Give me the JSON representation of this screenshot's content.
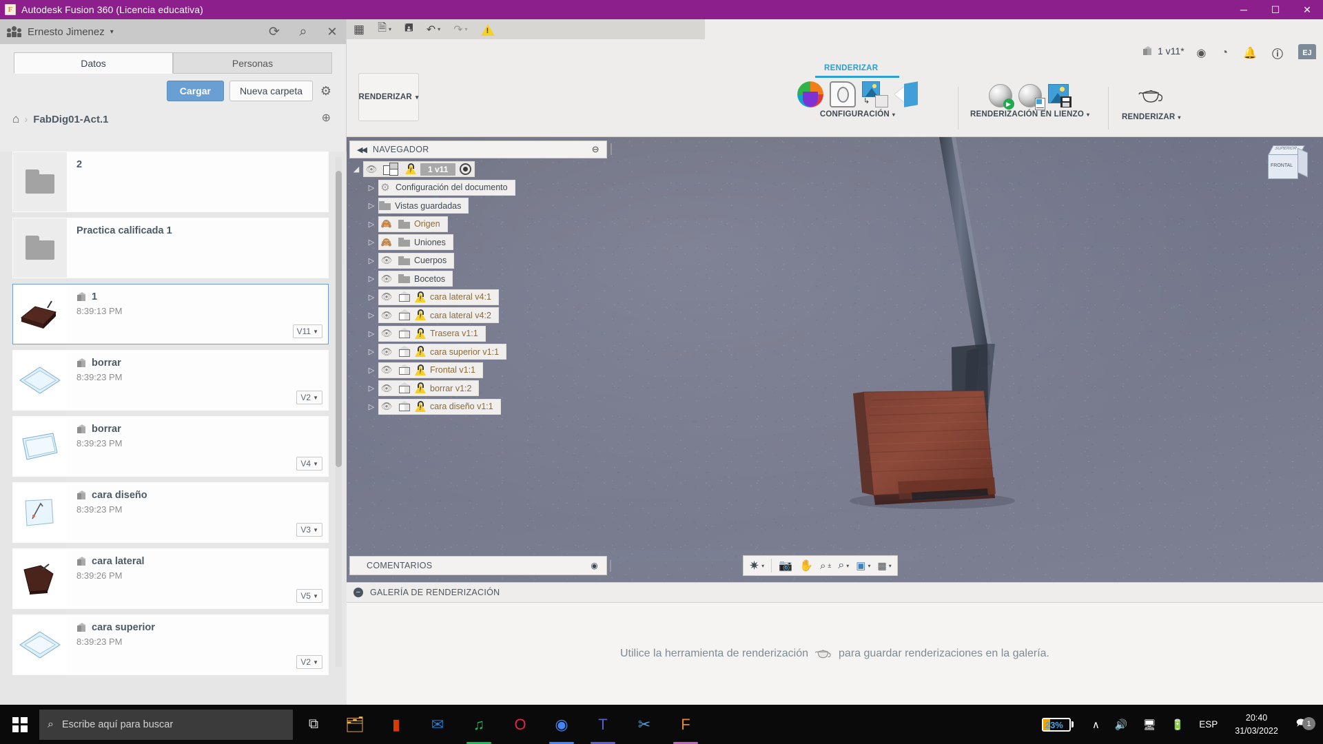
{
  "titlebar": {
    "app_title": "Autodesk Fusion 360 (Licencia educativa)",
    "logo_letter": "F",
    "minimize": "─",
    "maximize": "☐",
    "close": "✕",
    "accent_color": "#8d1f8d"
  },
  "data_panel": {
    "user_name": "Ernesto Jimenez",
    "user_caret": "▾",
    "refresh_icon": "⟳",
    "search_icon": "⌕",
    "close_icon": "✕",
    "tabs": [
      {
        "label": "Datos",
        "active": true
      },
      {
        "label": "Personas",
        "active": false
      }
    ],
    "upload_button": "Cargar",
    "new_folder_button": "Nueva carpeta",
    "settings_icon": "⚙",
    "breadcrumb": {
      "home_icon": "⌂",
      "separator": "›",
      "path": "FabDig01-Act.1",
      "globe_icon": "⊕"
    },
    "items": [
      {
        "type": "folder",
        "name": "2",
        "time": "",
        "version": ""
      },
      {
        "type": "folder",
        "name": "Practica calificada 1",
        "time": "",
        "version": ""
      },
      {
        "type": "file",
        "name": "1",
        "time": "8:39:13 PM",
        "version": "V11",
        "selected": true
      },
      {
        "type": "file",
        "name": "borrar",
        "time": "8:39:23 PM",
        "version": "V2",
        "selected": false
      },
      {
        "type": "file",
        "name": "borrar",
        "time": "8:39:23 PM",
        "version": "V4",
        "selected": false
      },
      {
        "type": "file",
        "name": "cara diseño",
        "time": "8:39:23 PM",
        "version": "V3",
        "selected": false
      },
      {
        "type": "file",
        "name": "cara lateral",
        "time": "8:39:26 PM",
        "version": "V5",
        "selected": false
      },
      {
        "type": "file",
        "name": "cara superior",
        "time": "8:39:23 PM",
        "version": "V2",
        "selected": false
      }
    ]
  },
  "fusion": {
    "quick_access": [
      {
        "name": "grid-icon",
        "glyph": "☷"
      },
      {
        "name": "new-file-icon",
        "glyph": "⬚",
        "caret": "▾"
      },
      {
        "name": "save-icon",
        "glyph": "⬜"
      },
      {
        "name": "undo-icon",
        "glyph": "↶",
        "caret": "▾"
      },
      {
        "name": "redo-icon",
        "glyph": "↷",
        "caret": "▾"
      },
      {
        "name": "warning-icon",
        "glyph": "⚠"
      }
    ],
    "document_tab": {
      "title": "1 v11*",
      "close": "✕",
      "add": "+"
    },
    "right_icons": [
      {
        "name": "extensions-icon",
        "glyph": "⊙"
      },
      {
        "name": "history-icon",
        "glyph": "◔"
      },
      {
        "name": "notifications-icon",
        "glyph": "🔔"
      },
      {
        "name": "help-icon",
        "glyph": "?"
      }
    ],
    "avatar_initials": "EJ",
    "workspace_button": "RENDERIZAR",
    "workspace_caret": "▾",
    "ribbon_tab": "RENDERIZAR",
    "ribbon_groups": [
      {
        "caption": "CONFIGURACIÓN",
        "caret": "▾",
        "tools": [
          "color-wheel-icon",
          "appearance-icon",
          "scene-settings-icon",
          "decal-icon"
        ]
      },
      {
        "caption": "RENDERIZACIÓN EN LIENZO",
        "caret": "▾",
        "tools": [
          "canvas-render-icon",
          "render-settings-icon",
          "capture-image-icon"
        ]
      },
      {
        "caption": "RENDERIZAR",
        "caret": "▾",
        "tools": [
          "teapot-render-icon"
        ]
      }
    ],
    "navigator": {
      "title": "NAVEGADOR",
      "collapse_icon": "◀◀",
      "minimize_icon": "⊖",
      "root": {
        "arrow": "◢",
        "eye": "◉",
        "version_chip": "1 v11",
        "radio": "◉"
      },
      "nodes": [
        {
          "arrow": "▷",
          "icon": "gear-icon",
          "eye": "",
          "label": "Configuración del documento",
          "warn": false,
          "orange": false
        },
        {
          "arrow": "▷",
          "icon": "folder-icon",
          "eye": "",
          "label": "Vistas guardadas",
          "warn": false,
          "orange": false
        },
        {
          "arrow": "▷",
          "icon": "folder-icon",
          "eye": "off",
          "label": "Origen",
          "warn": false,
          "orange": true
        },
        {
          "arrow": "▷",
          "icon": "folder-icon",
          "eye": "off",
          "label": "Uniones",
          "warn": false,
          "orange": false
        },
        {
          "arrow": "▷",
          "icon": "folder-icon",
          "eye": "on",
          "label": "Cuerpos",
          "warn": false,
          "orange": false
        },
        {
          "arrow": "▷",
          "icon": "folder-icon",
          "eye": "on",
          "label": "Bocetos",
          "warn": false,
          "orange": false
        },
        {
          "arrow": "▷",
          "icon": "component-icon",
          "eye": "on",
          "label": "cara lateral v4:1",
          "warn": true,
          "orange": true
        },
        {
          "arrow": "▷",
          "icon": "component-icon",
          "eye": "on",
          "label": "cara lateral v4:2",
          "warn": true,
          "orange": true
        },
        {
          "arrow": "▷",
          "icon": "component-icon",
          "eye": "on",
          "label": "Trasera v1:1",
          "warn": true,
          "orange": true
        },
        {
          "arrow": "▷",
          "icon": "component-icon",
          "eye": "on",
          "label": "cara superior v1:1",
          "warn": true,
          "orange": true
        },
        {
          "arrow": "▷",
          "icon": "component-icon",
          "eye": "on",
          "label": "Frontal v1:1",
          "warn": true,
          "orange": true
        },
        {
          "arrow": "▷",
          "icon": "component-icon",
          "eye": "on",
          "label": "borrar v1:2",
          "warn": true,
          "orange": true
        },
        {
          "arrow": "▷",
          "icon": "component-icon",
          "eye": "on",
          "label": "cara diseño v1:1",
          "warn": true,
          "orange": true
        }
      ]
    },
    "viewcube": {
      "front_label": "FRONTAL",
      "top_label": "SUPERIOR"
    },
    "comments": {
      "title": "COMENTARIOS",
      "add_icon": "◉"
    },
    "nav_toolbar": [
      {
        "name": "orbit-icon",
        "glyph": "✥",
        "caret": "▾"
      },
      {
        "name": "look-at-icon",
        "glyph": "⛶",
        "caret": ""
      },
      {
        "name": "pan-icon",
        "glyph": "✋",
        "caret": ""
      },
      {
        "name": "zoom-icon",
        "glyph": "⌕",
        "caret": ""
      },
      {
        "name": "zoom-window-icon",
        "glyph": "⌕",
        "caret": "▾"
      },
      {
        "name": "display-settings-icon",
        "glyph": "▣",
        "caret": "▾"
      },
      {
        "name": "grid-snaps-icon",
        "glyph": "▒",
        "caret": "▾"
      }
    ],
    "gallery": {
      "title": "GALERÍA DE RENDERIZACIÓN",
      "collapse_icon": "−",
      "empty_message_before": "Utilice la herramienta de renderización",
      "empty_message_after": "para guardar renderizaciones en la galería.",
      "teapot_icon": "teapot-icon"
    }
  },
  "taskbar": {
    "start_icon": "windows-logo-icon",
    "search_placeholder": "Escribe aquí para buscar",
    "search_icon": "⌕",
    "task_view_icon": "⧉",
    "apps": [
      {
        "name": "file-explorer",
        "glyph": "🗂",
        "color": "#f5ba45",
        "underline": ""
      },
      {
        "name": "office",
        "glyph": "▮",
        "color": "#d83b01",
        "underline": ""
      },
      {
        "name": "mail",
        "glyph": "✉",
        "color": "#1e7fd4",
        "underline": ""
      },
      {
        "name": "spotify",
        "glyph": "♫",
        "color": "#1db954",
        "underline": "#1db954"
      },
      {
        "name": "opera",
        "glyph": "O",
        "color": "#e0274b",
        "underline": ""
      },
      {
        "name": "chrome",
        "glyph": "◉",
        "color": "#4285f4",
        "underline": "#4285f4"
      },
      {
        "name": "teams",
        "glyph": "T",
        "color": "#5b5fc7",
        "underline": "#5b5fc7"
      },
      {
        "name": "scissors",
        "glyph": "✂",
        "color": "#4aa3df",
        "underline": ""
      },
      {
        "name": "fusion360",
        "glyph": "F",
        "color": "#e08a2e",
        "underline": "#c060c0"
      }
    ],
    "tray": {
      "battery_percent": "23%",
      "chevron_icon": "∧",
      "volume_icon": "🔊",
      "network_icon": "🖥",
      "battery_icon": "🔋",
      "language": "ESP",
      "time": "20:40",
      "date": "31/03/2022",
      "notification_icon": "🗪",
      "notification_count": "1"
    }
  }
}
